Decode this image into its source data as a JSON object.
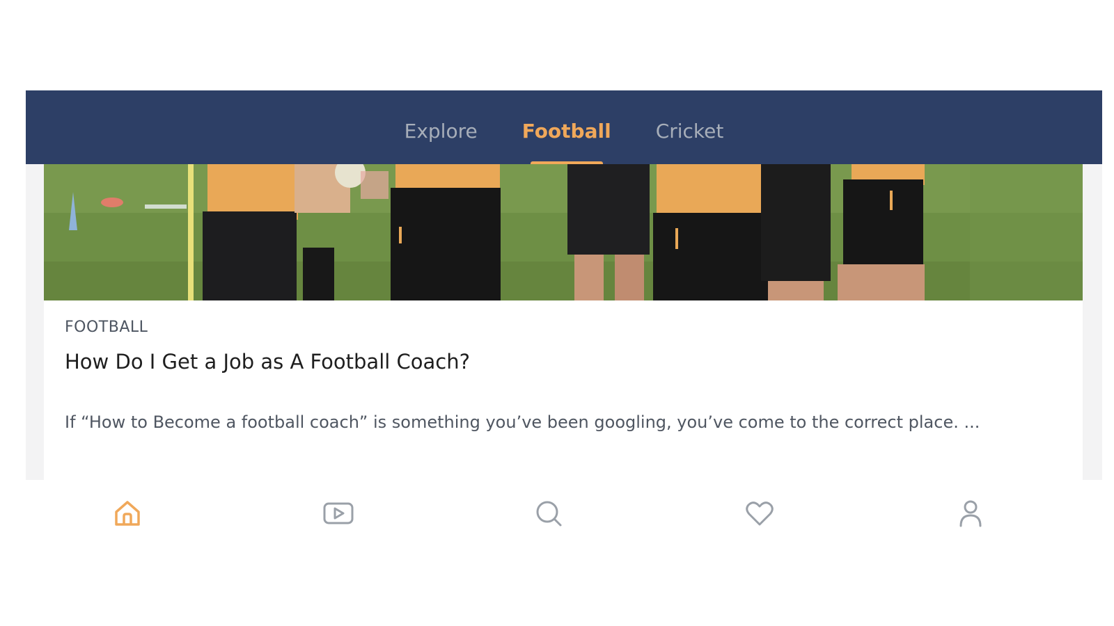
{
  "tabs": {
    "explore": "Explore",
    "football": "Football",
    "cricket": "Cricket",
    "active": "Football"
  },
  "article": {
    "category": "FOOTBALL",
    "title": "How Do I Get a Job as A Football Coach?",
    "excerpt": "If “How to Become a football coach” is something you’ve been googling, you’ve come to the correct place. ..."
  },
  "bottom_nav": [
    {
      "icon": "home-icon",
      "active": true
    },
    {
      "icon": "video-icon",
      "active": false
    },
    {
      "icon": "search-icon",
      "active": false
    },
    {
      "icon": "heart-icon",
      "active": false
    },
    {
      "icon": "profile-icon",
      "active": false
    }
  ],
  "colors": {
    "header": "#2d3f66",
    "accent": "#f0a85a",
    "inactive_tab": "#a7aeb9",
    "inactive_icon": "#9aa0a8"
  }
}
